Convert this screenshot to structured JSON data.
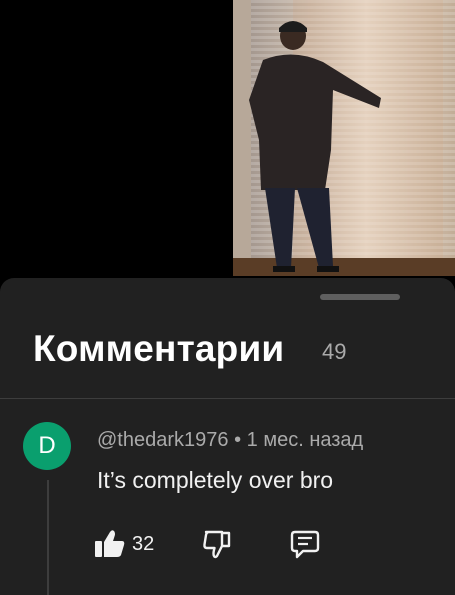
{
  "comments_panel": {
    "title": "Комментарии",
    "count": "49"
  },
  "comment": {
    "avatar_letter": "D",
    "author": "@thedark1976",
    "separator": "•",
    "time": "1 мес. назад",
    "text": "It’s completely over bro",
    "likes": "32"
  },
  "icons": {
    "like": "thumbs-up-icon",
    "dislike": "thumbs-down-icon",
    "reply": "comment-reply-icon"
  },
  "colors": {
    "sheet_bg": "#212121",
    "avatar_bg": "#0a9f6e",
    "secondary_text": "#aaaaaa"
  }
}
